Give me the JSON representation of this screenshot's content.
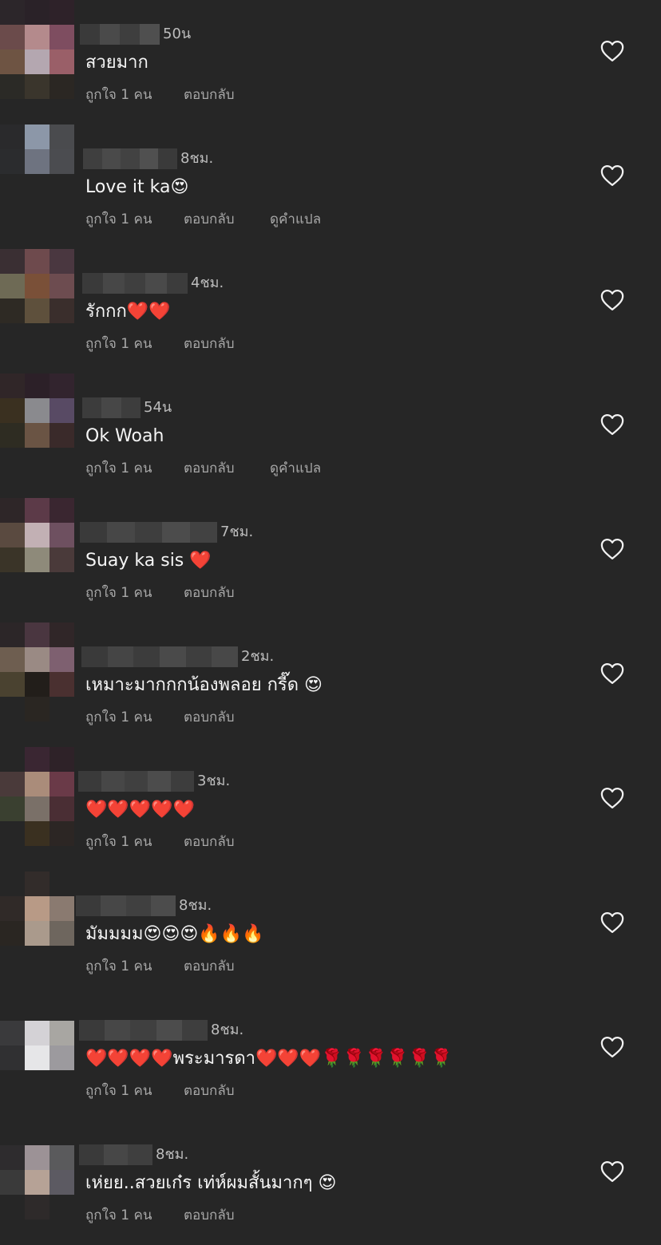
{
  "actions": {
    "like_count": "ถูกใจ 1 คน",
    "reply": "ตอบกลับ",
    "translate": "ดูคำแปล"
  },
  "icons": {
    "like": "heart-outline-icon"
  },
  "comments": [
    {
      "time": "50น",
      "text": "สวยมาก",
      "show_translate": false,
      "avatar": [
        "#2c262a",
        "#2a2228",
        "#2e2229",
        "#6b4b4b",
        "#b48a8c",
        "#7e4d60",
        "#6e5443",
        "#b4a7b0",
        "#9a5f68",
        "#2b2a26",
        "#3a352c",
        "#2b2723"
      ],
      "name_blocks": [
        "#3a3a3a",
        "#4a4a4a",
        "#3e3e3e",
        "#4f4f4f"
      ]
    },
    {
      "time": "8ชม.",
      "text": "Love it ka😍",
      "show_translate": true,
      "avatar": [
        "#2a2a2c",
        "#8c97a8",
        "#4a4b4e",
        "#2b2c2e",
        "#6e7380",
        "#4b4c50",
        "#262626",
        "#262626",
        "#262626",
        "#262626",
        "#262626",
        "#262626"
      ],
      "name_blocks": [
        "#3f3f3f",
        "#4a4a4a",
        "#424242",
        "#505050",
        "#3a3a3a"
      ]
    },
    {
      "time": "4ชม.",
      "text": "รักกก❤️❤️",
      "show_translate": false,
      "avatar": [
        "#3a2f33",
        "#6e4a4d",
        "#4a3740",
        "#6e6a55",
        "#7a5038",
        "#6d4c50",
        "#2e2a24",
        "#5e503c",
        "#3a2e2c",
        "#262626",
        "#262626",
        "#262626"
      ],
      "name_blocks": [
        "#3a3a3a",
        "#474747",
        "#3f3f3f",
        "#4a4a4a",
        "#3c3c3c"
      ]
    },
    {
      "time": "54น",
      "text": "Ok Woah",
      "show_translate": true,
      "avatar": [
        "#302628",
        "#2c2028",
        "#32242e",
        "#3a3020",
        "#8a8a8e",
        "#584a64",
        "#2e2c22",
        "#6a5444",
        "#3a2a2a",
        "#262626",
        "#262626",
        "#262626"
      ],
      "name_blocks": [
        "#3c3c3c",
        "#474747",
        "#3d3d3d"
      ]
    },
    {
      "time": "7ชม.",
      "text": "Suay ka sis ❤️",
      "show_translate": false,
      "avatar": [
        "#2e2628",
        "#5c3a48",
        "#3a2630",
        "#5a4a40",
        "#c2b0b4",
        "#6e5060",
        "#3a3428",
        "#8e8a7a",
        "#4a3a3a",
        "#262626",
        "#262626",
        "#262626"
      ],
      "name_blocks": [
        "#3a3a3a",
        "#474747",
        "#3e3e3e",
        "#4c4c4c",
        "#424242"
      ]
    },
    {
      "time": "2ชม.",
      "text": "เหมาะมากกกน้องพลอย กรี๊ด 😍",
      "show_translate": false,
      "avatar": [
        "#2c2628",
        "#4a3640",
        "#302628",
        "#6e5e50",
        "#9a8a84",
        "#7e6070",
        "#4a4230",
        "#221e1a",
        "#4a3030",
        "#262626",
        "#2a2622",
        "#262626"
      ],
      "name_blocks": [
        "#3a3a3a",
        "#454545",
        "#3c3c3c",
        "#4a4a4a",
        "#3e3e3e",
        "#484848"
      ]
    },
    {
      "time": "3ชม.",
      "text": "❤️❤️❤️❤️❤️",
      "show_translate": false,
      "avatar": [
        "#262626",
        "#3a2632",
        "#2e2228",
        "#4a3a3a",
        "#aa8c7a",
        "#6a3a48",
        "#3a4030",
        "#7a7068",
        "#4a2e34",
        "#262626",
        "#3a3020",
        "#2c2624"
      ],
      "name_blocks": [
        "#3a3a3a",
        "#474747",
        "#404040",
        "#4c4c4c",
        "#3d3d3d"
      ]
    },
    {
      "time": "8ชม.",
      "text": "มัมมมม😍😍😍🔥🔥🔥",
      "show_translate": false,
      "avatar": [
        "#262626",
        "#322c2a",
        "#262626",
        "#302a28",
        "#b89a86",
        "#8a7a70",
        "#2a2622",
        "#aa9a8c",
        "#6e665e",
        "#262626",
        "#262626",
        "#262626"
      ],
      "name_blocks": [
        "#3a3a3a",
        "#474747",
        "#404040",
        "#4c4c4c"
      ]
    },
    {
      "time": "8ชม.",
      "text": "❤️❤️❤️❤️พระมารดา❤️❤️❤️🌹🌹🌹🌹🌹🌹",
      "show_translate": false,
      "avatar": [
        "#262626",
        "#262626",
        "#262626",
        "#3a3a3c",
        "#d4d2d6",
        "#a8a6a2",
        "#303032",
        "#e6e6e8",
        "#9c9a9e",
        "#262626",
        "#262626",
        "#262626"
      ],
      "name_blocks": [
        "#3a3a3a",
        "#474747",
        "#404040",
        "#4c4c4c",
        "#3e3e3e"
      ]
    },
    {
      "time": "8ชม.",
      "text": "เห่ยย..สวยเก๋ร เท่ห์ผมสั้นมากๆ 😍",
      "show_translate": false,
      "avatar": [
        "#262626",
        "#262626",
        "#262626",
        "#2e2c2e",
        "#9c9296",
        "#5a5a5c",
        "#3a3a3a",
        "#b6a296",
        "#5c5a62",
        "#262626",
        "#2e2a2a",
        "#262626"
      ],
      "name_blocks": [
        "#3a3a3a",
        "#474747",
        "#3f3f3f"
      ]
    }
  ]
}
